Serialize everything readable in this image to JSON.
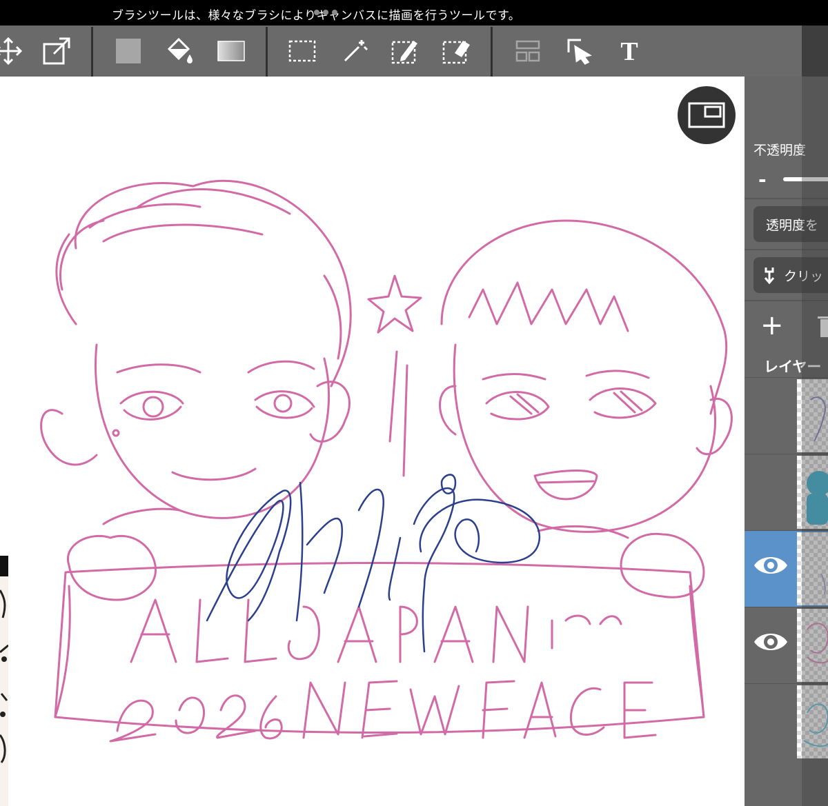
{
  "tip_bar": {
    "text": "ブラシツールは、様々なブラシによりキャンバスに描画を行うツールです。"
  },
  "toolbar": {
    "tools": [
      "move",
      "transform",
      "fill-color",
      "bucket",
      "gradient",
      "selection",
      "magic-wand",
      "selection-pen",
      "selection-eraser",
      "layout",
      "select-object",
      "text"
    ]
  },
  "canvas": {
    "artwork_text_line1": "ALL JAPAN men",
    "artwork_text_line2": "2026 NEW FACE",
    "line_color": "#d26aa6",
    "signature_color": "#2b3f8c"
  },
  "panel": {
    "opacity_label": "不透明度",
    "opacity_minus": "-",
    "opacity_lock_button": "透明度を",
    "clipping_button": "クリッ",
    "add_layer": "+",
    "layers_title": "レイヤー",
    "layers": [
      {
        "visible": false,
        "selected": false,
        "thumb_color": "#8f8fc8"
      },
      {
        "visible": false,
        "selected": false,
        "thumb_color": "#4ab8d8"
      },
      {
        "visible": true,
        "selected": true,
        "thumb_color": "#b0b0d8"
      },
      {
        "visible": true,
        "selected": false,
        "thumb_color": "#e493c0"
      },
      {
        "visible": false,
        "selected": false,
        "thumb_color": "#6ac8e0"
      }
    ],
    "selected_color": "#5b92c9"
  }
}
